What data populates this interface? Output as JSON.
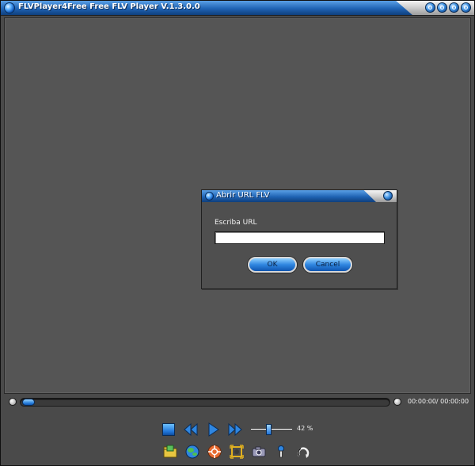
{
  "window": {
    "title": "FLVPlayer4Free Free FLV Player V.1.3.0.0",
    "controls": [
      "minimize-icon",
      "restore-icon",
      "maximize-icon",
      "close-icon"
    ]
  },
  "dialog": {
    "title": "Abrir URL FLV",
    "url_label": "Escriba URL",
    "url_value": "",
    "ok_label": "OK",
    "cancel_label": "Cancel"
  },
  "playback": {
    "time": "00:00:00/ 00:00:00",
    "seek_progress": 0,
    "volume_text": "42 %",
    "volume_level": 0.42
  },
  "transport": {
    "icons": [
      "stop-icon",
      "rewind-icon",
      "play-icon",
      "fast-forward-icon"
    ]
  },
  "toolbar": {
    "icons": [
      "open-file-icon",
      "open-url-globe-icon",
      "settings-icon",
      "fullscreen-icon",
      "snapshot-camera-icon",
      "info-icon",
      "loop-icon"
    ]
  },
  "colors": {
    "accent": "#1f63b4",
    "button_blue": "#2f86e0",
    "video_bg": "#555555",
    "window_bg": "#4a4a4a"
  }
}
